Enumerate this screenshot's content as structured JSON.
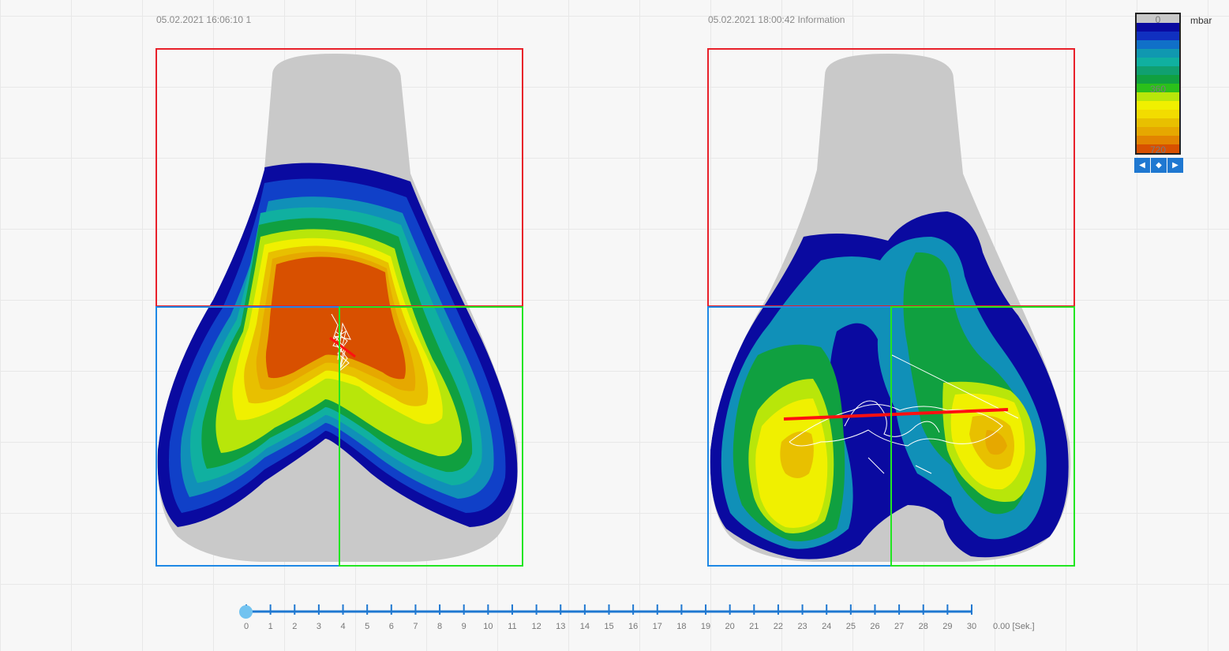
{
  "panels": [
    {
      "timestamp": "05.02.2021 16:06:10 1"
    },
    {
      "timestamp": "05.02.2021 18:00:42 Information"
    }
  ],
  "legend": {
    "unit": "mbar",
    "labels": [
      "0",
      "360",
      "720"
    ],
    "colors": [
      "#c8c8c8",
      "#0a0aa0",
      "#1030c0",
      "#1070c8",
      "#1098b0",
      "#10b0a0",
      "#10a070",
      "#10a040",
      "#2bc01a",
      "#b8e60a",
      "#f0f000",
      "#f2dc00",
      "#e8c000",
      "#e6a800",
      "#e28400",
      "#d85000"
    ]
  },
  "controls": {
    "prev_icon": "left-arrow-icon",
    "center_icon": "diamond-icon",
    "next_icon": "right-arrow-icon"
  },
  "timeline": {
    "ticks": [
      "0",
      "1",
      "2",
      "3",
      "4",
      "5",
      "6",
      "7",
      "8",
      "9",
      "10",
      "11",
      "12",
      "13",
      "14",
      "15",
      "16",
      "17",
      "18",
      "19",
      "20",
      "21",
      "22",
      "23",
      "24",
      "25",
      "26",
      "27",
      "28",
      "29",
      "30"
    ],
    "readout": "0.00 [Sek.]",
    "position_seconds": 0
  },
  "colors": {
    "zone_top": "#e8202a",
    "zone_left": "#1e88e5",
    "zone_right": "#22e622",
    "cop_line": "#ff1010",
    "track_blue": "#1f78d1"
  }
}
